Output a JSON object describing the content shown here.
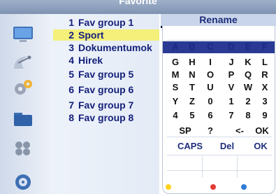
{
  "title": "Favorite",
  "rename_label": "Rename",
  "channels": [
    {
      "num": "1",
      "name": "Fav group 1",
      "tone": "dark"
    },
    {
      "num": "2",
      "name": "Sport",
      "tone": "dark",
      "selected": true
    },
    {
      "num": "3",
      "name": "Dokumentumok",
      "tone": "dark"
    },
    {
      "num": "4",
      "name": "Hirek",
      "tone": "dark"
    },
    {
      "num": "5",
      "name": "Fav group 5",
      "tone": "dark"
    },
    {
      "num": "6",
      "name": "Fav group 6",
      "tone": "dark"
    },
    {
      "num": "7",
      "name": "Fav group 7",
      "tone": "dark"
    },
    {
      "num": "8",
      "name": "Fav group 8",
      "tone": "dark"
    }
  ],
  "keyboard": {
    "rows": [
      [
        "A",
        "B",
        "C",
        "D",
        "E",
        "F"
      ],
      [
        "G",
        "H",
        "I",
        "J",
        "K",
        "L"
      ],
      [
        "M",
        "N",
        "O",
        "P",
        "Q",
        "R"
      ],
      [
        "S",
        "T",
        "U",
        "V",
        "W",
        "X"
      ],
      [
        "Y",
        "Z",
        "0",
        "1",
        "2",
        "3"
      ],
      [
        "4",
        "5",
        "6",
        "7",
        "8",
        "9"
      ]
    ],
    "sp": "SP",
    "question": "?",
    "back": "<-",
    "ok": "OK",
    "caps": "CAPS",
    "del": "Del",
    "ok2": "OK"
  },
  "icons": [
    "tv-icon",
    "satellite-dish-icon",
    "settings-gears-icon",
    "folder-icon",
    "game-controller-icon",
    "dial-icon"
  ],
  "colors": {
    "accent": "#2a3a94",
    "selection": "#f4f07a",
    "header": "#c9d5ea"
  },
  "color_buttons": [
    "yellow",
    "red",
    "blue"
  ]
}
